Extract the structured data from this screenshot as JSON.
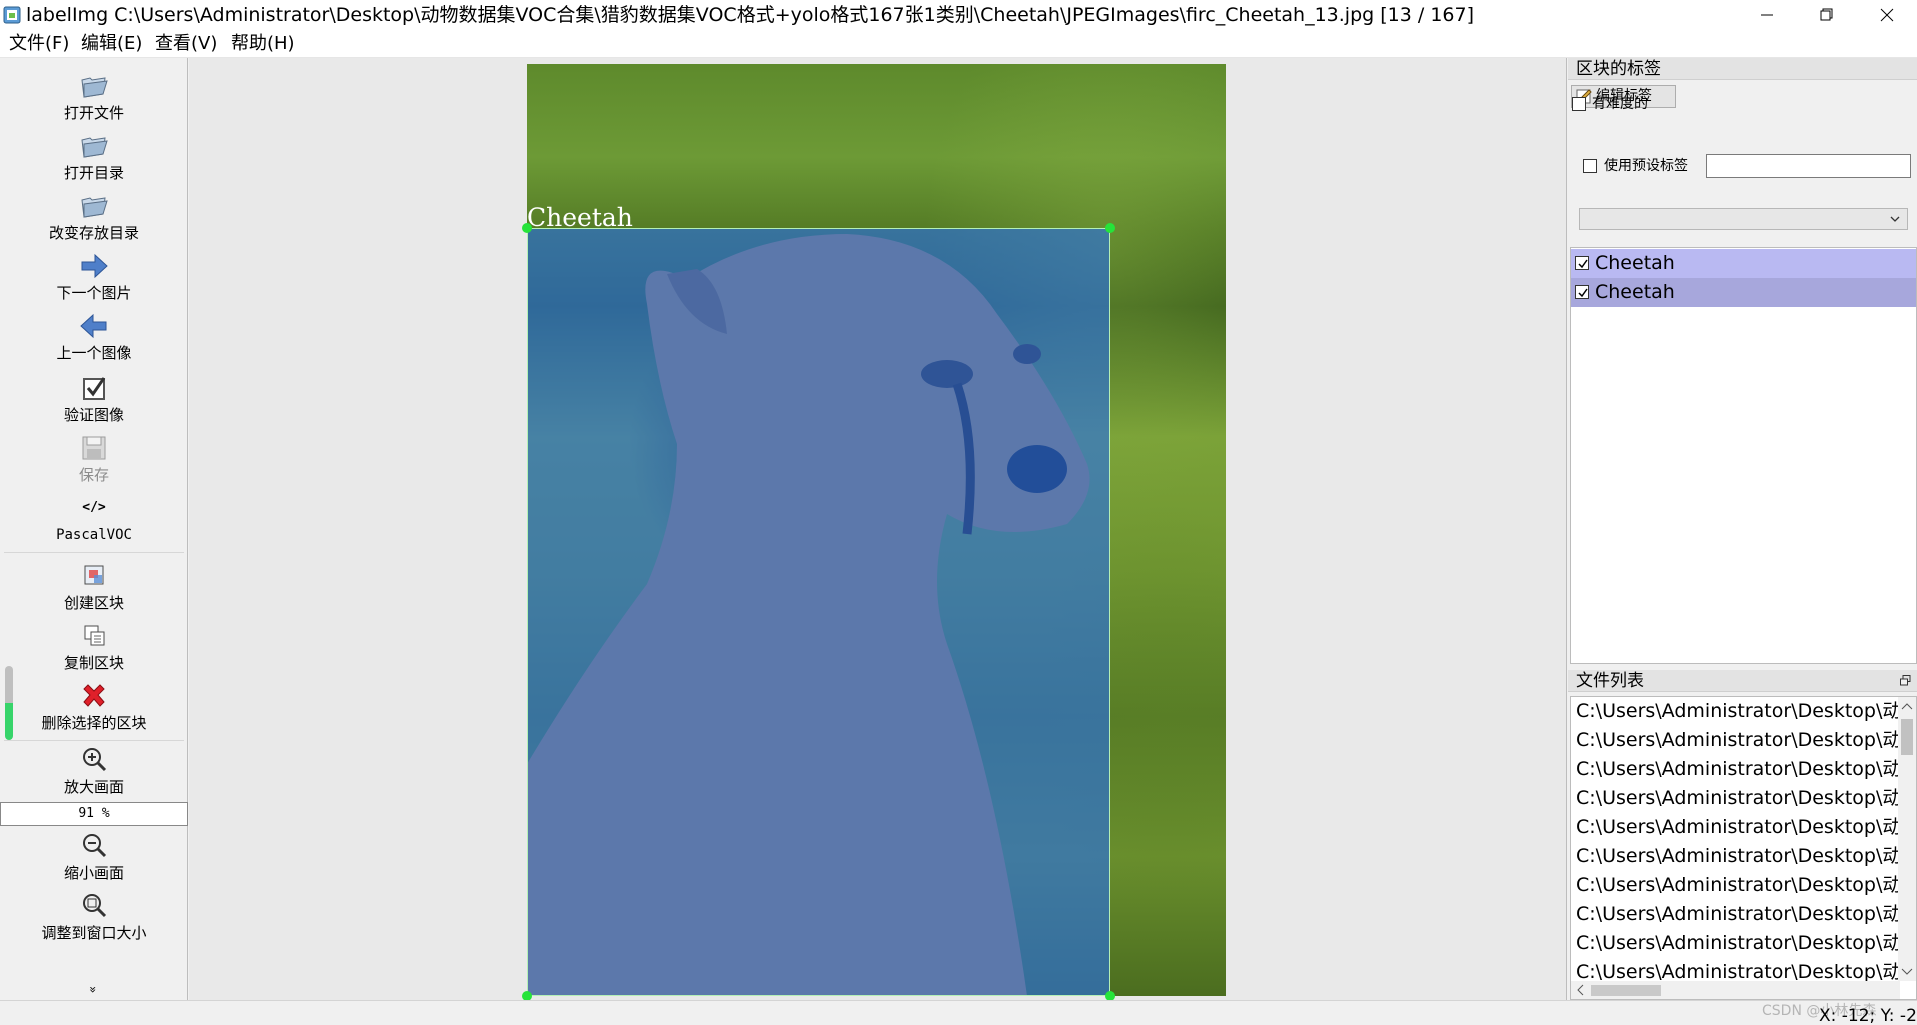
{
  "window": {
    "title": "labelImg C:\\Users\\Administrator\\Desktop\\动物数据集VOC合集\\猎豹数据集VOC格式+yolo格式167张1类别\\Cheetah\\JPEGImages\\firc_Cheetah_13.jpg [13 / 167]"
  },
  "menu": [
    {
      "label": "文件(F)"
    },
    {
      "label": "编辑(E)"
    },
    {
      "label": "查看(V)"
    },
    {
      "label": "帮助(H)"
    }
  ],
  "toolbar": {
    "open_file": "打开文件",
    "open_dir": "打开目录",
    "change_save_dir": "改变存放目录",
    "next_image": "下一个图片",
    "prev_image": "上一个图像",
    "verify_image": "验证图像",
    "save": "保存",
    "format_icon_text": "</>",
    "format": "PascalVOC",
    "create_box": "创建区块",
    "duplicate_box": "复制区块",
    "delete_box": "删除选择的区块",
    "zoom_in": "放大画面",
    "zoom_value": "91 %",
    "zoom_out": "缩小画面",
    "fit_window": "调整到窗口大小",
    "extend_glyph": "»"
  },
  "canvas": {
    "box_label": "Cheetah"
  },
  "labels_dock": {
    "title": "区块的标签",
    "edit_label_button": "编辑标签",
    "difficult_label": "有难度的",
    "difficult_checked": false,
    "use_default_label": "使用预设标签",
    "use_default_checked": false,
    "default_label_value": "",
    "combo_value": "",
    "items": [
      {
        "text": "Cheetah",
        "checked": true,
        "color": "#b9b9f2"
      },
      {
        "text": "Cheetah",
        "checked": true,
        "color": "#a7a7dc"
      }
    ]
  },
  "files_dock": {
    "title": "文件列表",
    "rows": [
      "C:\\Users\\Administrator\\Desktop\\动",
      "C:\\Users\\Administrator\\Desktop\\动",
      "C:\\Users\\Administrator\\Desktop\\动",
      "C:\\Users\\Administrator\\Desktop\\动",
      "C:\\Users\\Administrator\\Desktop\\动",
      "C:\\Users\\Administrator\\Desktop\\动",
      "C:\\Users\\Administrator\\Desktop\\动",
      "C:\\Users\\Administrator\\Desktop\\动",
      "C:\\Users\\Administrator\\Desktop\\动",
      "C:\\Users\\Administrator\\Desktop\\动"
    ]
  },
  "status": {
    "coords": "X: -12; Y: -2",
    "watermark": "CSDN @小林先森"
  }
}
